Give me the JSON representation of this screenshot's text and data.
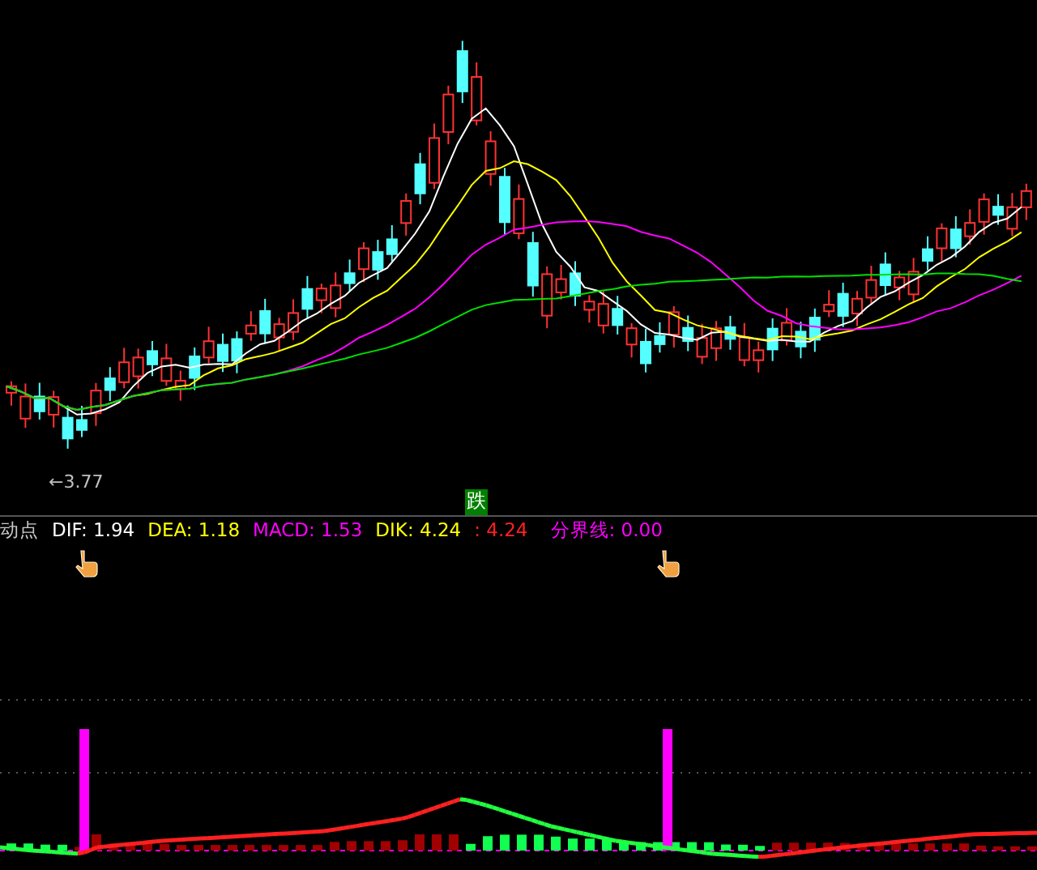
{
  "price_chart": {
    "low_marker": "←3.77",
    "signal_label": "跌"
  },
  "indicator": {
    "name": "动点",
    "values": [
      {
        "label": "DIF:",
        "value": "1.94",
        "color": "#ffffff"
      },
      {
        "label": "DEA:",
        "value": "1.18",
        "color": "#ffff00"
      },
      {
        "label": "MACD:",
        "value": "1.53",
        "color": "#ff00ff"
      },
      {
        "label": "DIK:",
        "value": "4.24",
        "color": "#ffff00"
      },
      {
        "label": ":",
        "value": "4.24",
        "color": "#ff2020"
      },
      {
        "label": "分界线:",
        "value": "0.00",
        "color": "#ff00ff"
      }
    ]
  }
}
